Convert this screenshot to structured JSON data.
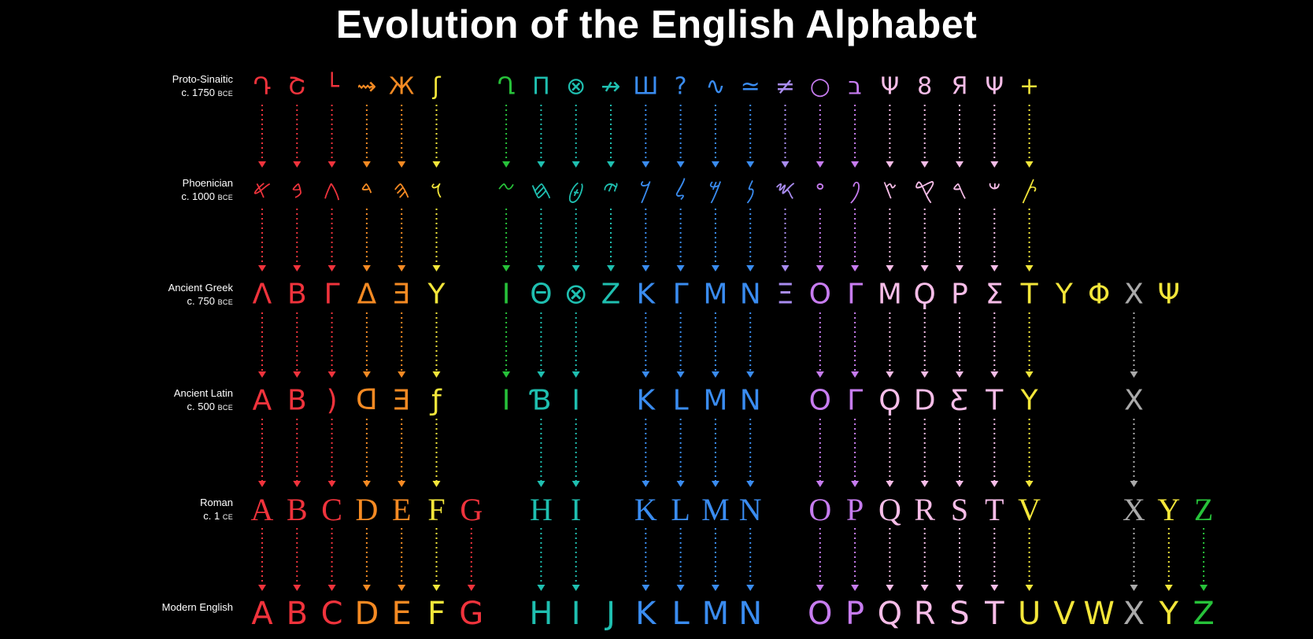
{
  "title": "Evolution of the English Alphabet",
  "rows": [
    {
      "label": "Proto-Sinaitic",
      "era": "c. 1750",
      "suffix": "BCE"
    },
    {
      "label": "Phoenician",
      "era": "c. 1000",
      "suffix": "BCE"
    },
    {
      "label": "Ancient Greek",
      "era": "c. 750",
      "suffix": "BCE"
    },
    {
      "label": "Ancient Latin",
      "era": "c. 500",
      "suffix": "BCE"
    },
    {
      "label": "Roman",
      "era": "c. 1",
      "suffix": "CE"
    },
    {
      "label": "Modern English",
      "era": "",
      "suffix": ""
    }
  ],
  "colors": {
    "background": "#000000",
    "text": "#ffffff",
    "palette": [
      "#f0333c",
      "#f0333c",
      "#f0333c",
      "#f58a23",
      "#f58a23",
      "#f3e63a",
      "#27c23a",
      "#1fbfb0",
      "#1fbfb0",
      "#1fbfb0",
      "#3a8cf0",
      "#3a8cf0",
      "#3a8cf0",
      "#3a8cf0",
      "#a98cf0",
      "#c77cf0",
      "#c77cf0",
      "#f7bde8",
      "#f7bde8",
      "#f7bde8",
      "#f7bde8",
      "#f3e63a",
      "#f3e63a",
      "#f3e63a",
      "#aaaaaa",
      "#f3e63a",
      "#27c23a"
    ]
  },
  "columns": [
    {
      "name": "A",
      "proto": "Դ",
      "phoen": "𐤀",
      "greek": "Λ",
      "latin": "A",
      "roman": "A",
      "modern": "A",
      "c": 0
    },
    {
      "name": "B",
      "proto": "Շ",
      "phoen": "𐤁",
      "greek": "Β",
      "latin": "B",
      "roman": "B",
      "modern": "B",
      "c": 1
    },
    {
      "name": "C",
      "proto": "└",
      "phoen": "𐤂",
      "greek": "Γ",
      "latin": ")",
      "roman": "C",
      "modern": "C",
      "c": 2
    },
    {
      "name": "D",
      "proto": "⇝",
      "phoen": "𐤃",
      "greek": "Δ",
      "latin": "ᗡ",
      "roman": "D",
      "modern": "D",
      "c": 3
    },
    {
      "name": "E",
      "proto": "Ж",
      "phoen": "𐤄",
      "greek": "Ǝ",
      "latin": "Ǝ",
      "roman": "E",
      "modern": "E",
      "c": 4
    },
    {
      "name": "F",
      "proto": "ʃ",
      "phoen": "𐤅",
      "greek": "Y",
      "latin": "ƒ",
      "roman": "F",
      "modern": "F",
      "c": 5
    },
    {
      "name": "G",
      "proto": "",
      "phoen": "",
      "greek": "",
      "latin": "",
      "roman": "G",
      "modern": "G",
      "c": 0
    },
    {
      "name": "Z1",
      "proto": "Ղ",
      "phoen": "𐤆",
      "greek": "I",
      "latin": "I",
      "roman": "",
      "modern": "",
      "c": 6
    },
    {
      "name": "H",
      "proto": "Π",
      "phoen": "𐤇",
      "greek": "Θ",
      "latin": "Ɓ",
      "roman": "H",
      "modern": "H",
      "c": 7
    },
    {
      "name": "I",
      "proto": "⊗",
      "phoen": "𐤈",
      "greek": "⊗",
      "latin": "I",
      "roman": "I",
      "modern": "I",
      "c": 8
    },
    {
      "name": "J",
      "proto": "↛",
      "phoen": "𐤉",
      "greek": "Z",
      "latin": "",
      "roman": "",
      "modern": "J",
      "c": 9
    },
    {
      "name": "K",
      "proto": "Ш",
      "phoen": "𐤊",
      "greek": "K",
      "latin": "K",
      "roman": "K",
      "modern": "K",
      "c": 10
    },
    {
      "name": "L",
      "proto": "?",
      "phoen": "𐤋",
      "greek": "Γ",
      "latin": "L",
      "roman": "L",
      "modern": "L",
      "c": 11
    },
    {
      "name": "M",
      "proto": "∿",
      "phoen": "𐤌",
      "greek": "M",
      "latin": "M",
      "roman": "M",
      "modern": "M",
      "c": 12
    },
    {
      "name": "N",
      "proto": "≃",
      "phoen": "𐤍",
      "greek": "N",
      "latin": "N",
      "roman": "N",
      "modern": "N",
      "c": 13
    },
    {
      "name": "X1",
      "proto": "≠",
      "phoen": "𐤎",
      "greek": "Ξ",
      "latin": "",
      "roman": "",
      "modern": "",
      "c": 14
    },
    {
      "name": "O",
      "proto": "○",
      "phoen": "𐤏",
      "greek": "O",
      "latin": "O",
      "roman": "O",
      "modern": "O",
      "c": 15
    },
    {
      "name": "P",
      "proto": "ב",
      "phoen": "𐤐",
      "greek": "Γ",
      "latin": "Γ",
      "roman": "P",
      "modern": "P",
      "c": 15
    },
    {
      "name": "Q",
      "proto": "Ψ",
      "phoen": "𐤑",
      "greek": "M",
      "latin": "Ϙ",
      "roman": "Q",
      "modern": "Q",
      "c": 17
    },
    {
      "name": "R",
      "proto": "8",
      "phoen": "𐤒",
      "greek": "Ϙ",
      "latin": "D",
      "roman": "R",
      "modern": "R",
      "c": 17
    },
    {
      "name": "S",
      "proto": "Я",
      "phoen": "𐤓",
      "greek": "P",
      "latin": "Ƹ",
      "roman": "S",
      "modern": "S",
      "c": 17
    },
    {
      "name": "T",
      "proto": "Ψ",
      "phoen": "𐤔",
      "greek": "Σ",
      "latin": "T",
      "roman": "T",
      "modern": "T",
      "c": 17
    },
    {
      "name": "U",
      "proto": "+",
      "phoen": "𐤕",
      "greek": "T",
      "latin": "Y",
      "roman": "V",
      "modern": "U",
      "c": 21
    },
    {
      "name": "V",
      "proto": "",
      "phoen": "",
      "greek": "Y",
      "latin": "",
      "roman": "",
      "modern": "V",
      "c": 21
    },
    {
      "name": "W",
      "proto": "",
      "phoen": "",
      "greek": "Φ",
      "latin": "",
      "roman": "",
      "modern": "W",
      "c": 21
    },
    {
      "name": "X",
      "proto": "",
      "phoen": "",
      "greek": "X",
      "latin": "X",
      "roman": "X",
      "modern": "X",
      "c": 24
    },
    {
      "name": "Y",
      "proto": "",
      "phoen": "",
      "greek": "Ψ",
      "latin": "",
      "roman": "Y",
      "modern": "Y",
      "c": 25
    },
    {
      "name": "Z",
      "proto": "",
      "phoen": "",
      "greek": "",
      "latin": "",
      "roman": "Z",
      "modern": "Z",
      "c": 26
    }
  ]
}
